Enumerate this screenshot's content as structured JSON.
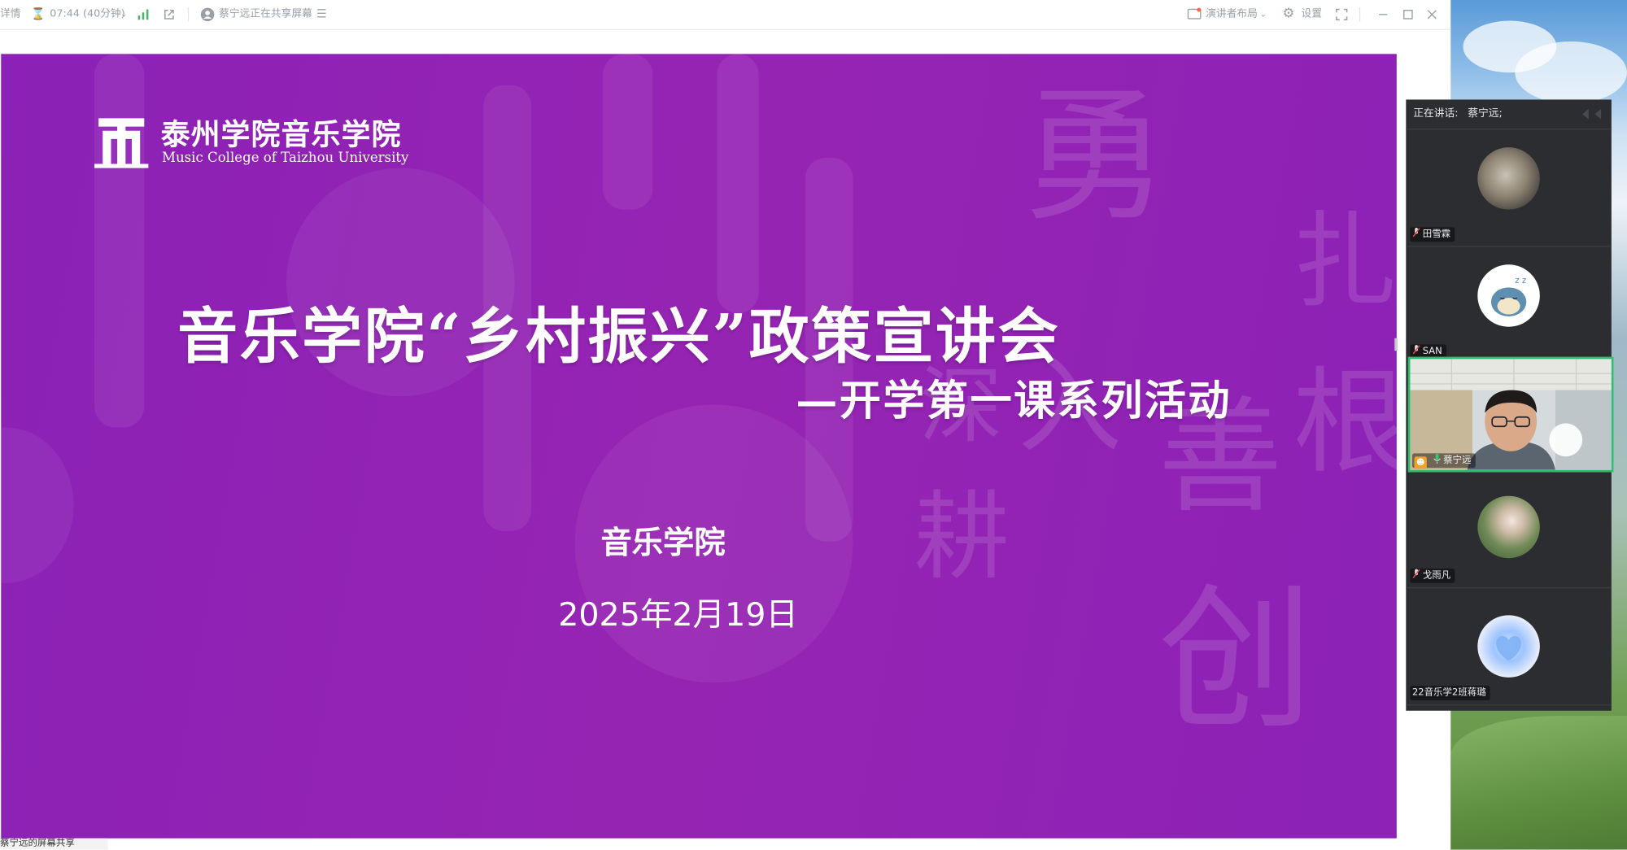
{
  "toolbar": {
    "details_label": "详情",
    "meeting_duration": "07:44 (40分钟)",
    "sharing_status": "蔡宁远正在共享屏幕",
    "presenter_layout_label": "演讲者布局",
    "settings_label": "设置"
  },
  "slide": {
    "logo_cn": "泰州学院音乐学院",
    "logo_en": "Music College of Taizhou University",
    "title": "音乐学院“乡村振兴”政策宣讲会",
    "subtitle": "—开学第一课系列活动",
    "organizer": "音乐学院",
    "date": "2025年2月19日",
    "decor_chars": [
      "勇",
      "扎",
      "根",
      "耕",
      "善",
      "创",
      "深",
      "入"
    ]
  },
  "share_tag": "蔡宁远的屏幕共享",
  "panel": {
    "speaking_label": "正在讲话:",
    "speaking_name": "蔡宁远;",
    "participants": [
      {
        "name": "田雪霖",
        "avatar": "cat-photo-avatar",
        "muted": true
      },
      {
        "name": "SAN",
        "avatar": "sleeping-cartoon-avatar",
        "muted": true
      },
      {
        "name": "蔡宁远",
        "avatar": "camera-video",
        "host": true,
        "active": true
      },
      {
        "name": "戈雨凡",
        "avatar": "portrait-photo-avatar",
        "muted": true
      },
      {
        "name": "22音乐学2班蒋璐",
        "avatar": "blue-heart-avatar",
        "muted": false
      }
    ]
  },
  "colors": {
    "slide_purple": "#9424b4",
    "active_border": "#27c06b",
    "panel_bg": "#2b2d30"
  }
}
